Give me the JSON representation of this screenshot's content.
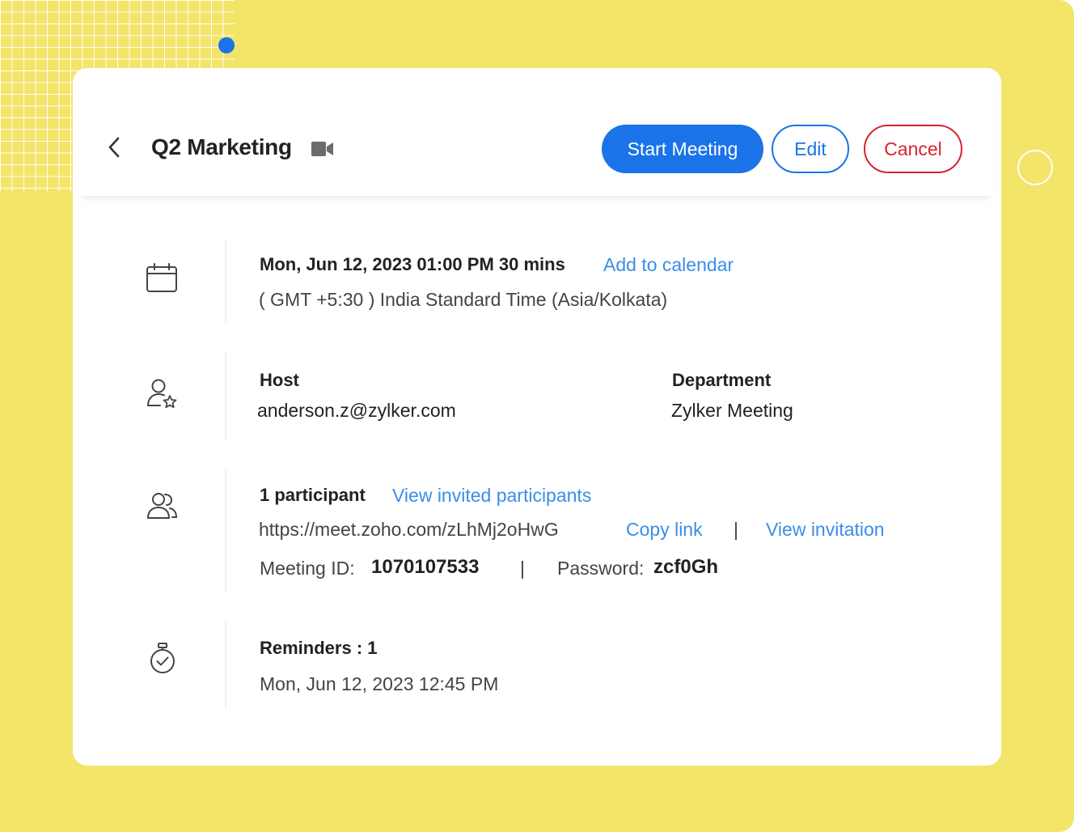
{
  "header": {
    "title": "Q2 Marketing",
    "start_label": "Start Meeting",
    "edit_label": "Edit",
    "cancel_label": "Cancel"
  },
  "schedule": {
    "datetime": "Mon, Jun 12, 2023 01:00 PM 30 mins",
    "add_calendar": "Add to calendar",
    "timezone": "( GMT +5:30 ) India Standard Time (Asia/Kolkata)"
  },
  "host": {
    "host_label": "Host",
    "host_value": "anderson.z@zylker.com",
    "dept_label": "Department",
    "dept_value": "Zylker Meeting"
  },
  "participants": {
    "count": "1 participant",
    "view_invited": "View invited participants",
    "link": "https://meet.zoho.com/zLhMj2oHwG",
    "copy_link": "Copy link",
    "separator": "|",
    "view_invitation": "View invitation",
    "meeting_id_label": "Meeting ID:",
    "meeting_id_value": "1070107533",
    "password_label": "Password:",
    "password_value": "zcf0Gh"
  },
  "reminders": {
    "label": "Reminders : 1",
    "time": "Mon, Jun 12, 2023 12:45 PM"
  },
  "colors": {
    "background": "#f3e46a",
    "primary": "#1a73e8",
    "link": "#3a8ee6",
    "danger": "#d9232d"
  }
}
